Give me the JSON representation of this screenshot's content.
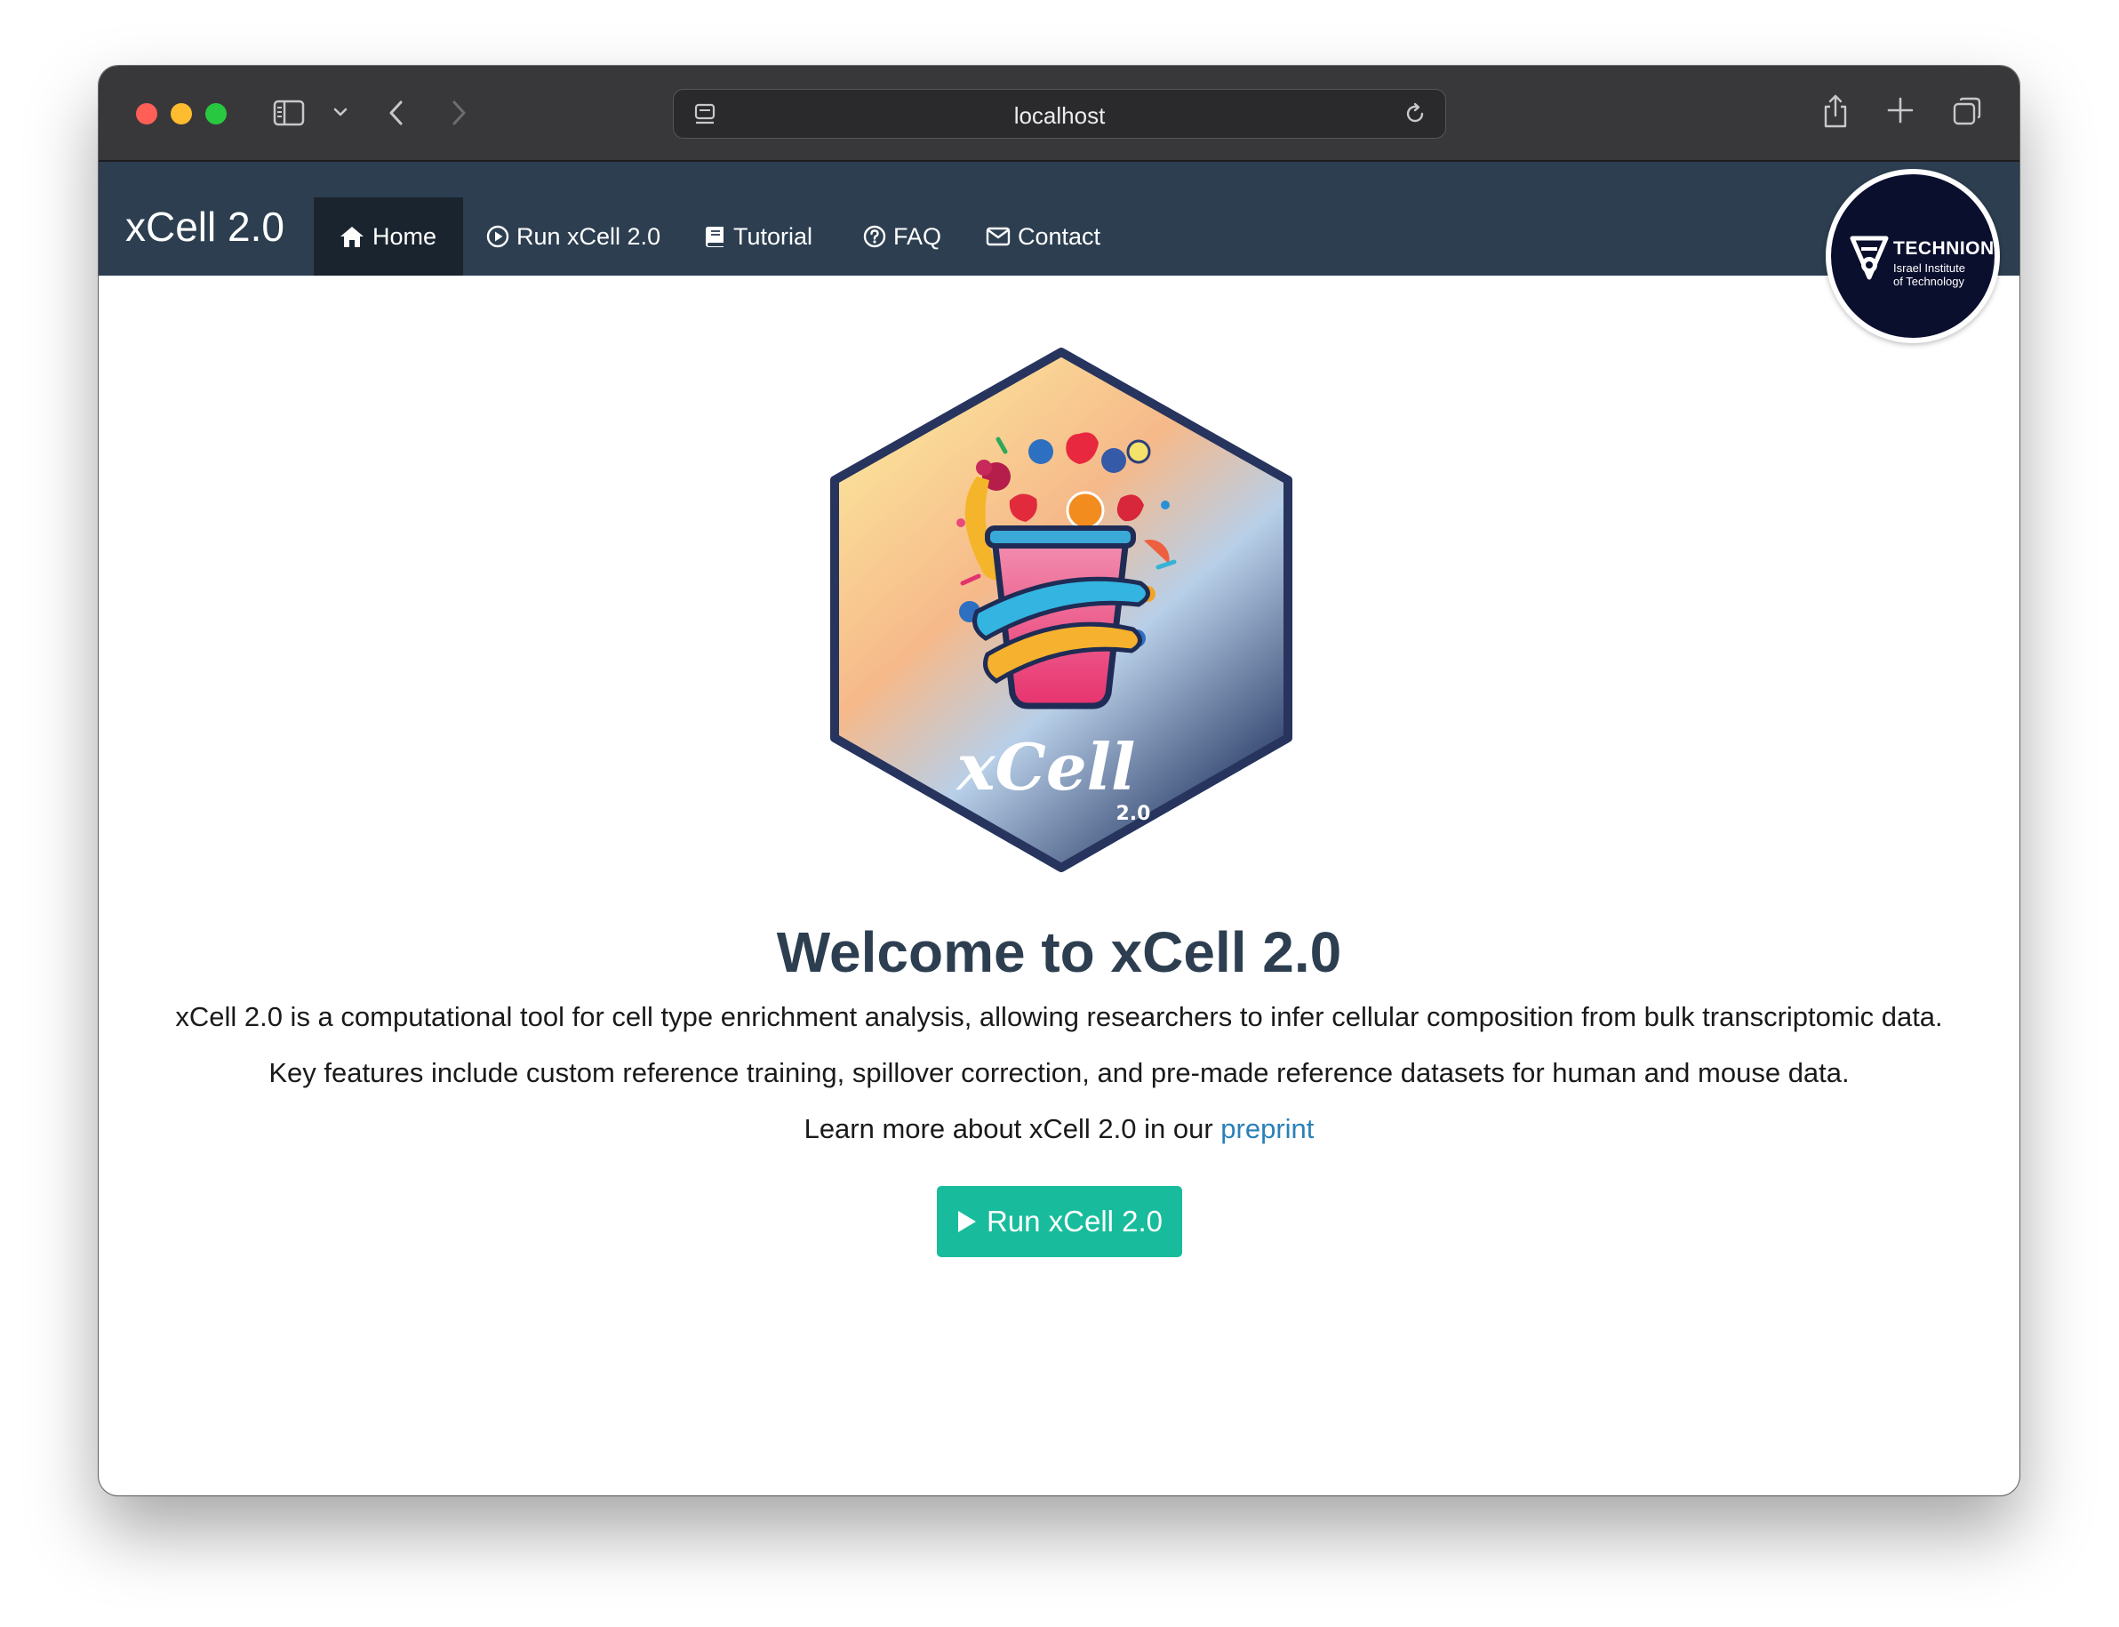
{
  "browser": {
    "address": "localhost"
  },
  "navbar": {
    "brand": "xCell 2.0",
    "items": [
      {
        "label": "Home",
        "icon": "home-icon",
        "active": true
      },
      {
        "label": "Run xCell 2.0",
        "icon": "play-circle-icon",
        "active": false
      },
      {
        "label": "Tutorial",
        "icon": "book-icon",
        "active": false
      },
      {
        "label": "FAQ",
        "icon": "question-circle-icon",
        "active": false
      },
      {
        "label": "Contact",
        "icon": "envelope-icon",
        "active": false
      }
    ]
  },
  "partner_logo": {
    "title": "TECHNION",
    "subtitle_line1": "Israel Institute",
    "subtitle_line2": "of Technology"
  },
  "hero": {
    "logo_text": "xCell",
    "logo_version": "2.0",
    "title": "Welcome to xCell 2.0",
    "description": "xCell 2.0 is a computational tool for cell type enrichment analysis, allowing researchers to infer cellular composition from bulk transcriptomic data.",
    "features": "Key features include custom reference training, spillover correction, and pre-made reference datasets for human and mouse data.",
    "learn_more_prefix": "Learn more about xCell 2.0 in our ",
    "learn_more_link": "preprint",
    "cta_label": "Run xCell 2.0"
  },
  "colors": {
    "navbar": "#2c3e50",
    "navbar_active": "#1a242f",
    "cta": "#18bc9c",
    "link": "#2980b9",
    "title": "#2c3e50"
  }
}
